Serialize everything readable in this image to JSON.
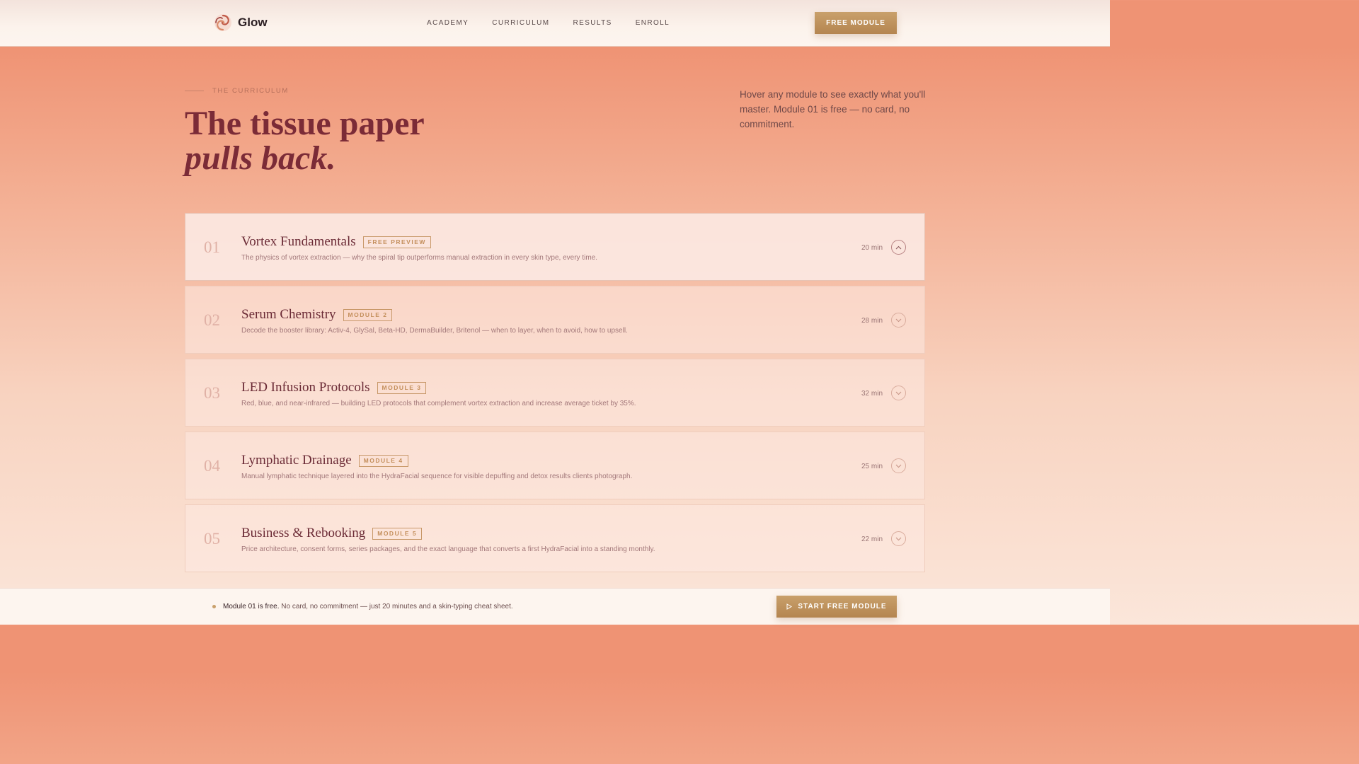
{
  "header": {
    "brand": "Glow",
    "nav": [
      "ACADEMY",
      "CURRICULUM",
      "RESULTS",
      "ENROLL"
    ],
    "cta_label": "FREE MODULE"
  },
  "hero": {
    "eyebrow": "THE CURRICULUM",
    "title_line1": "The tissue paper",
    "title_line2": "pulls back.",
    "description": "Hover any module to see exactly what you'll master. Module 01 is free — no card, no commitment."
  },
  "modules": [
    {
      "num": "01",
      "title": "Vortex Fundamentals",
      "tag": "FREE PREVIEW",
      "desc": "The physics of vortex extraction — why the spiral tip outperforms manual extraction in every skin type, every time.",
      "duration": "20 min",
      "expanded": true
    },
    {
      "num": "02",
      "title": "Serum Chemistry",
      "tag": "MODULE 2",
      "desc": "Decode the booster library: Activ-4, GlySal, Beta-HD, DermaBuilder, Britenol — when to layer, when to avoid, how to upsell.",
      "duration": "28 min",
      "expanded": false
    },
    {
      "num": "03",
      "title": "LED Infusion Protocols",
      "tag": "MODULE 3",
      "desc": "Red, blue, and near-infrared — building LED protocols that complement vortex extraction and increase average ticket by 35%.",
      "duration": "32 min",
      "expanded": false
    },
    {
      "num": "04",
      "title": "Lymphatic Drainage",
      "tag": "MODULE 4",
      "desc": "Manual lymphatic technique layered into the HydraFacial sequence for visible depuffing and detox results clients photograph.",
      "duration": "25 min",
      "expanded": false
    },
    {
      "num": "05",
      "title": "Business & Rebooking",
      "tag": "MODULE 5",
      "desc": "Price architecture, consent forms, series packages, and the exact language that converts a first HydraFacial into a standing monthly.",
      "duration": "22 min",
      "expanded": false
    }
  ],
  "bottom_bar": {
    "lead": "Module 01 is free.",
    "rest": " No card, no commitment — just 20 minutes and a skin-typing cheat sheet.",
    "cta_label": "START FREE MODULE"
  }
}
